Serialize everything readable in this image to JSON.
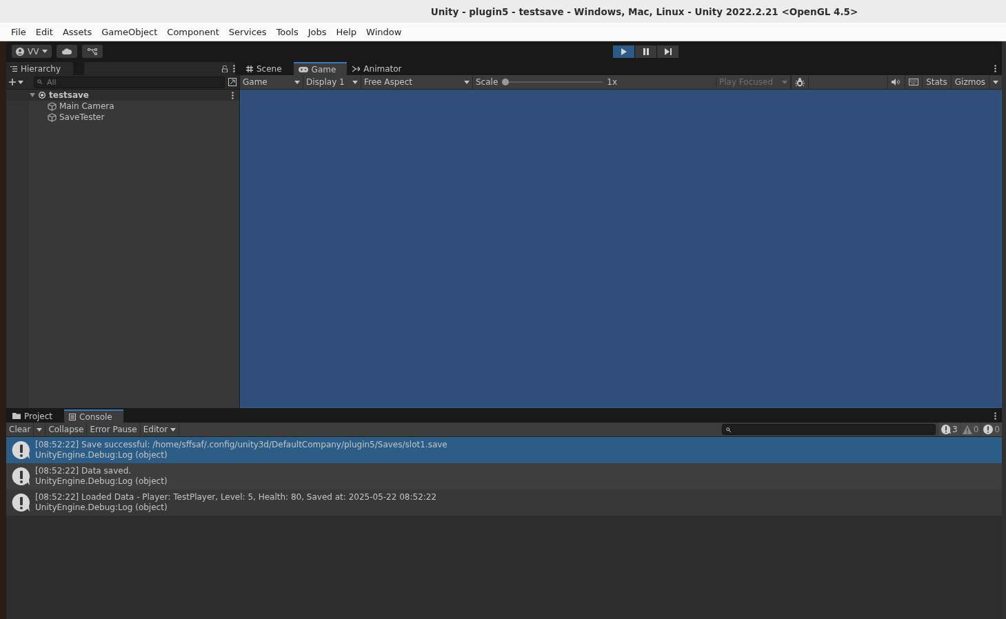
{
  "window": {
    "title": "Unity - plugin5 - testsave - Windows, Mac, Linux - Unity 2022.2.21 <OpenGL 4.5>"
  },
  "menu": [
    "File",
    "Edit",
    "Assets",
    "GameObject",
    "Component",
    "Services",
    "Tools",
    "Jobs",
    "Help",
    "Window"
  ],
  "toolbar": {
    "account": "VV",
    "play_controls": [
      {
        "kind": "play",
        "selected": true
      },
      {
        "kind": "pause",
        "selected": false
      },
      {
        "kind": "step",
        "selected": false
      }
    ]
  },
  "hierarchy": {
    "tab": "Hierarchy",
    "search": {
      "placeholder": "All"
    },
    "tree": [
      {
        "label": "testsave",
        "expanded": true,
        "children": [
          {
            "label": "Main Camera"
          },
          {
            "label": "SaveTester"
          }
        ]
      }
    ]
  },
  "game_view": {
    "tabs": [
      {
        "kind": "scene",
        "label": "Scene",
        "selected": false
      },
      {
        "kind": "game",
        "label": "Game",
        "selected": true
      },
      {
        "kind": "animator",
        "label": "Animator",
        "selected": false
      }
    ],
    "toolbar": {
      "view": "Game",
      "display": "Display 1",
      "aspect": "Free Aspect",
      "scale_label": "Scale",
      "scale": {
        "level": 0
      },
      "scale_reading": "1x",
      "play_mode": "Play Focused",
      "stats": "Stats",
      "gizmos": "Gizmos"
    }
  },
  "console": {
    "tabs": [
      {
        "kind": "project",
        "label": "Project",
        "selected": false
      },
      {
        "kind": "console",
        "label": "Console",
        "selected": true
      }
    ],
    "toolbar": {
      "clear": "Clear",
      "collapse": "Collapse",
      "error_pause": "Error Pause",
      "editor": "Editor"
    },
    "counts": [
      {
        "kind": "info",
        "count": "3"
      },
      {
        "kind": "warning",
        "count": "0"
      },
      {
        "kind": "error",
        "count": "0"
      }
    ],
    "entries": [
      {
        "message": "[08:52:22] Save successful: /home/sffsaf/.config/unity3d/DefaultCompany/plugin5/Saves/slot1.save",
        "trace": "UnityEngine.Debug:Log (object)",
        "selected": true
      },
      {
        "message": "[08:52:22] Data saved.",
        "trace": "UnityEngine.Debug:Log (object)",
        "selected": false
      },
      {
        "message": "[08:52:22] Loaded Data - Player: TestPlayer, Level: 5, Health: 80, Saved at: 2025-05-22 08:52:22",
        "trace": "UnityEngine.Debug:Log (object)",
        "selected": false
      }
    ]
  }
}
